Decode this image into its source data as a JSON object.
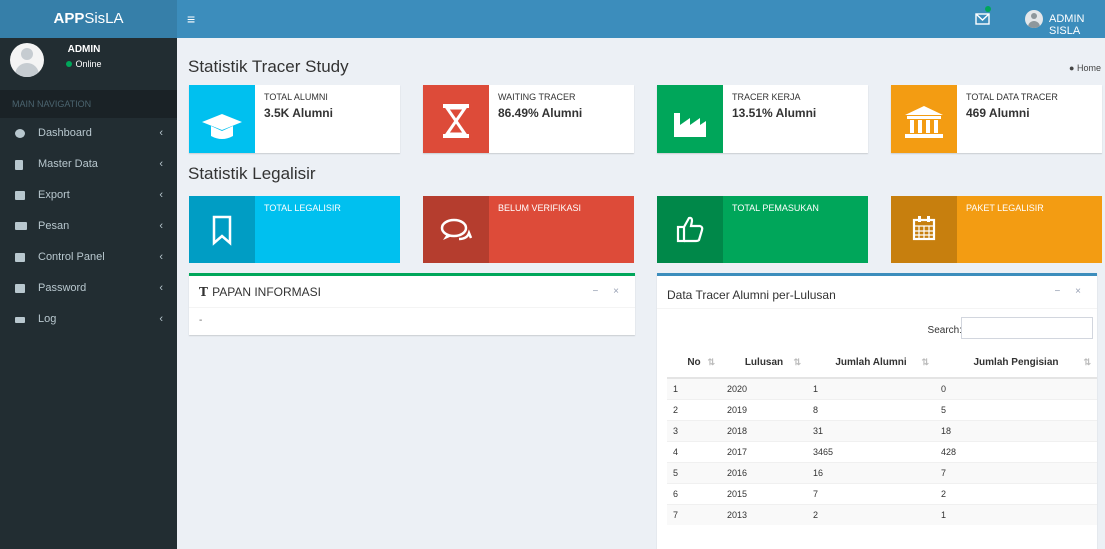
{
  "brand": {
    "bold": "APP",
    "light": "SisLA"
  },
  "topbar": {
    "toggle_icon": "≡",
    "user_name": "ADMIN SISLA"
  },
  "sidebar": {
    "user_name": "ADMIN",
    "user_status": "Online",
    "header": "MAIN NAVIGATION",
    "items": [
      {
        "label": "Dashboard",
        "icon": "dashboard-icon"
      },
      {
        "label": "Master Data",
        "icon": "file-icon"
      },
      {
        "label": "Export",
        "icon": "export-icon"
      },
      {
        "label": "Pesan",
        "icon": "folder-icon"
      },
      {
        "label": "Control Panel",
        "icon": "sliders-icon"
      },
      {
        "label": "Password",
        "icon": "lock-icon"
      },
      {
        "label": "Log",
        "icon": "random-icon"
      }
    ],
    "chevron": "‹"
  },
  "page": {
    "title1": "Statistik Tracer Study",
    "breadcrumb": "Home",
    "title2": "Statistik Legalisir"
  },
  "tracer_boxes": [
    {
      "label": "TOTAL ALUMNI",
      "value": "3.5K Alumni",
      "color": "#00c0ef",
      "icon": "graduation-cap-icon"
    },
    {
      "label": "WAITING TRACER",
      "value": "86.49% Alumni",
      "color": "#dd4b39",
      "icon": "hourglass-icon"
    },
    {
      "label": "TRACER KERJA",
      "value": "13.51% Alumni",
      "color": "#00a65a",
      "icon": "industry-icon"
    },
    {
      "label": "TOTAL DATA TRACER",
      "value": "469 Alumni",
      "color": "#f39c12",
      "icon": "institution-icon"
    }
  ],
  "legalisir_boxes": [
    {
      "label": "TOTAL LEGALISIR",
      "color": "#00c0ef",
      "icon": "bookmark-icon"
    },
    {
      "label": "BELUM VERIFIKASI",
      "color": "#dd4b39",
      "icon": "comments-icon"
    },
    {
      "label": "TOTAL PEMASUKAN",
      "color": "#00a65a",
      "icon": "thumbs-up-icon"
    },
    {
      "label": "PAKET LEGALISIR",
      "color": "#f39c12",
      "icon": "calendar-icon"
    }
  ],
  "papan": {
    "title": "PAPAN INFORMASI",
    "body": "-",
    "tools": "− ×"
  },
  "table_box": {
    "title": "Data Tracer Alumni per-Lulusan",
    "search_label": "Search:",
    "tools": "− ×",
    "columns": [
      "No",
      "Lulusan",
      "Jumlah Alumni",
      "Jumlah Pengisian"
    ],
    "rows": [
      [
        "1",
        "2020",
        "1",
        "0"
      ],
      [
        "2",
        "2019",
        "8",
        "5"
      ],
      [
        "3",
        "2018",
        "31",
        "18"
      ],
      [
        "4",
        "2017",
        "3465",
        "428"
      ],
      [
        "5",
        "2016",
        "16",
        "7"
      ],
      [
        "6",
        "2015",
        "7",
        "2"
      ],
      [
        "7",
        "2013",
        "2",
        "1"
      ]
    ]
  }
}
